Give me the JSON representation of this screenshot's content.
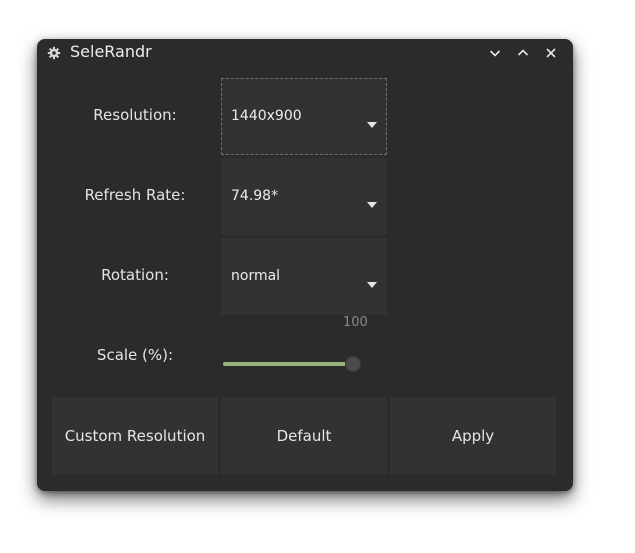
{
  "window": {
    "title": "SeleRandr",
    "icon": "gear-icon",
    "controls": [
      "minimize-icon",
      "maximize-icon",
      "close-icon"
    ]
  },
  "resolution": {
    "label": "Resolution:",
    "value": "1440x900"
  },
  "refresh_rate": {
    "label": "Refresh Rate:",
    "value": "74.98*"
  },
  "rotation": {
    "label": "Rotation:",
    "value": "normal"
  },
  "scale": {
    "label": "Scale (%):",
    "value": "100",
    "fraction": 1.0
  },
  "buttons": {
    "custom_resolution": "Custom Resolution",
    "default": "Default",
    "apply": "Apply"
  },
  "colors": {
    "window_bg": "#2b2b2b",
    "widget_bg": "#323232",
    "slider_fill": "#98b47a"
  }
}
